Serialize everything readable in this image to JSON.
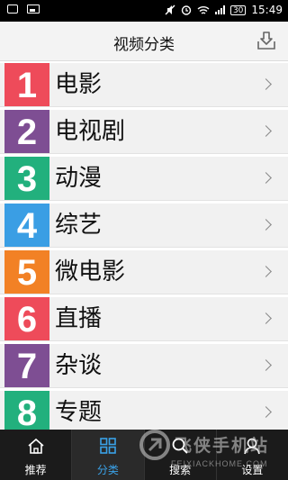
{
  "status_bar": {
    "time": "15:49",
    "battery": "30"
  },
  "header": {
    "title": "视频分类",
    "action_icon": "download-icon"
  },
  "categories": [
    {
      "number": "1",
      "label": "电影",
      "color": "#ee4b5a"
    },
    {
      "number": "2",
      "label": "电视剧",
      "color": "#7e4e93"
    },
    {
      "number": "3",
      "label": "动漫",
      "color": "#22b07d"
    },
    {
      "number": "4",
      "label": "综艺",
      "color": "#3a9ee4"
    },
    {
      "number": "5",
      "label": "微电影",
      "color": "#f28125"
    },
    {
      "number": "6",
      "label": "直播",
      "color": "#ee4b5a"
    },
    {
      "number": "7",
      "label": "杂谈",
      "color": "#7e4e93"
    },
    {
      "number": "8",
      "label": "专题",
      "color": "#22b07d"
    }
  ],
  "bottom_nav": [
    {
      "label": "推荐",
      "icon": "home-icon"
    },
    {
      "label": "分类",
      "icon": "grid-icon",
      "active": true
    },
    {
      "label": "搜索",
      "icon": "search-icon"
    },
    {
      "label": "设置",
      "icon": "user-icon"
    }
  ],
  "accent_color": "#3aa2e8",
  "watermark": {
    "text": "飞侠手机站",
    "sub": "FEIXIACKHOME.COM"
  }
}
